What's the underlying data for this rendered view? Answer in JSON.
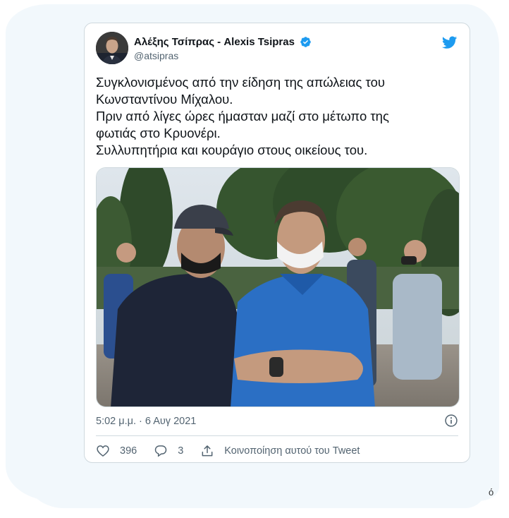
{
  "tweet": {
    "display_name": "Αλέξης Τσίπρας - Alexis Tsipras",
    "handle": "@atsipras",
    "text_lines": [
      "Συγκλονισμένος από την είδηση της απώλειας του",
      "Κωνσταντίνου Μίχαλου.",
      "Πριν από λίγες ώρες ήμασταν μαζί στο μέτωπο της",
      "φωτιάς στο Κρυονέρι.",
      "Συλλυπητήρια και κουράγιο στους οικείους του."
    ],
    "timestamp": "5:02 μ.μ. · 6 Αυγ 2021",
    "likes": "396",
    "replies": "3",
    "share_label": "Κοινοποίηση αυτού του Tweet"
  },
  "page": {
    "corner_text": "ό"
  },
  "colors": {
    "twitter_blue": "#1d9bf0",
    "text_primary": "#0f1419",
    "text_secondary": "#536471",
    "border": "#cfd9de",
    "background_blob": "#f2f8fc"
  },
  "icons": {
    "brand": "twitter-bird-icon",
    "verified": "verified-badge-icon",
    "info": "info-icon",
    "like": "heart-icon",
    "reply": "reply-bubble-icon",
    "share": "share-upload-icon"
  }
}
